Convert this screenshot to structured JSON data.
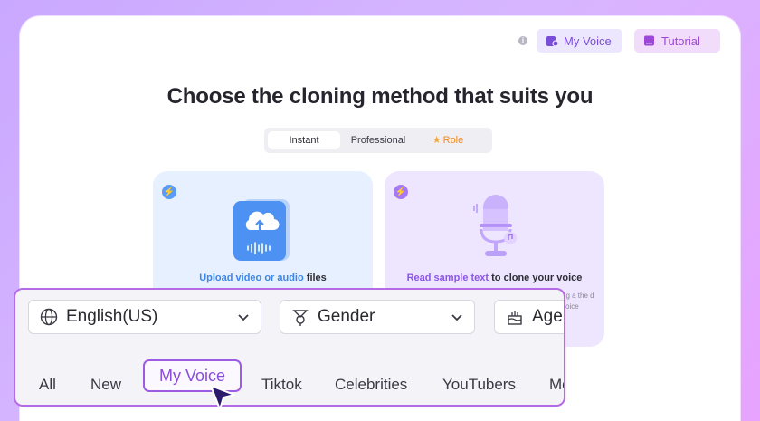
{
  "header": {
    "my_voice_label": "My Voice",
    "tutorial_label": "Tutorial",
    "info_icon": "info-icon"
  },
  "headline": "Choose the cloning method that suits you",
  "method_tabs": [
    {
      "label": "Instant",
      "selected": true
    },
    {
      "label": "Professional",
      "selected": false
    },
    {
      "label": "Role",
      "selected": false
    }
  ],
  "cards": {
    "upload": {
      "label_highlight": "Upload video or audio",
      "label_rest": " files"
    },
    "record": {
      "label_highlight": "Read sample text",
      "label_rest": " to clone your voice",
      "desc": "ng a the d voice"
    }
  },
  "filters": {
    "language": "English(US)",
    "gender": "Gender",
    "age": "Age"
  },
  "categories": [
    "All",
    "New",
    "My Voice",
    "Tiktok",
    "Celebrities",
    "YouTubers",
    "Mo"
  ],
  "selected_category": "My Voice",
  "colors": {
    "accent_purple": "#8a4ddb",
    "role_orange": "#f08a1b",
    "upload_blue": "#3b86ea"
  }
}
